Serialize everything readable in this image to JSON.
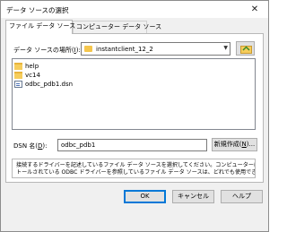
{
  "window": {
    "title": "データ ソースの選択"
  },
  "tabs": [
    {
      "label": "ファイル データ ソース",
      "active": true
    },
    {
      "label": "コンピューター データ ソース",
      "active": false
    }
  ],
  "location": {
    "label_text": "データ ソースの場所(",
    "label_key": "I",
    "label_end": "):",
    "value": "instantclient_12_2"
  },
  "files": [
    {
      "name": "help",
      "type": "folder"
    },
    {
      "name": "vc14",
      "type": "folder"
    },
    {
      "name": "odbc_pdb1.dsn",
      "type": "dsn"
    }
  ],
  "dsn": {
    "label_text": "DSN 名(",
    "label_key": "D",
    "label_end": "):",
    "value": "odbc_pdb1"
  },
  "new_button": {
    "text": "新規作成(",
    "key": "N",
    "end": ")..."
  },
  "description": {
    "line1": "接続するドライバーを記述しているファイル データ ソースを選択してください。コンピューターにインス",
    "line2": "トールされている ODBC ドライバーを参照しているファイル データ ソースは、どれでも使用できます。"
  },
  "footer": {
    "ok": "OK",
    "cancel": "キャンセル",
    "help": "ヘルプ"
  },
  "colors": {
    "accent": "#0078d7",
    "folder": "#f6cd5c",
    "dialog_bg": "#f0f0f0"
  },
  "icons": {
    "close": "close-icon",
    "up_folder": "up-folder-icon",
    "folder": "folder-icon",
    "dsn_file": "dsn-file-icon"
  }
}
